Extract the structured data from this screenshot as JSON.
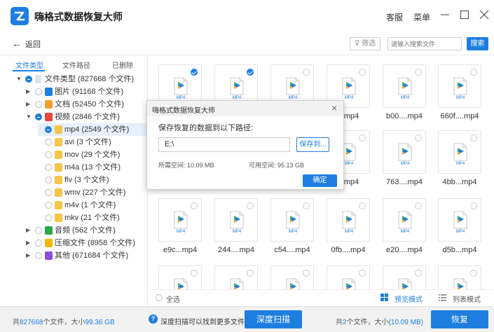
{
  "window": {
    "title": "嗨格式数据恢复大师",
    "service": "客服",
    "menu": "菜单"
  },
  "toolbar": {
    "back": "返回",
    "filter": "筛选",
    "search_placeholder": "请输入搜索文件",
    "search_button": "搜索"
  },
  "tabs": [
    "文件类型",
    "文件路径",
    "已删除"
  ],
  "tree": [
    {
      "label": "文件类型 (827668 个文件)"
    },
    {
      "label": "图片 (91168 个文件)",
      "color": "#1e7ee0"
    },
    {
      "label": "文档 (52450 个文件)",
      "color": "#f0a030"
    },
    {
      "label": "视频 (2846 个文件)",
      "color": "#e8453c"
    },
    {
      "label": "mp4 (2549 个文件)"
    },
    {
      "label": "avi (3 个文件)"
    },
    {
      "label": "mov (29 个文件)"
    },
    {
      "label": "m4a (13 个文件)"
    },
    {
      "label": "flv (3 个文件)"
    },
    {
      "label": "wmv (227 个文件)"
    },
    {
      "label": "m4v (1 个文件)"
    },
    {
      "label": "mkv (21 个文件)"
    },
    {
      "label": "音频 (562 个文件)",
      "color": "#2aa84a"
    },
    {
      "label": "压缩文件 (8958 个文件)",
      "color": "#f5b800"
    },
    {
      "label": "其他 (671684 个文件)",
      "color": "#8a4fd8"
    }
  ],
  "grid": {
    "badge": "MP4",
    "row2": [
      "",
      "",
      "...mp4",
      "b00....mp4",
      "660f....mp4"
    ],
    "row3": [
      "",
      "",
      "...mp4",
      "763....mp4",
      "4bb...mp4"
    ],
    "row4": [
      "e9c...mp4",
      "244....mp4",
      "c54....mp4",
      "0fb....mp4",
      "e20....mp4",
      "d5b...mp4"
    ]
  },
  "bottom": {
    "select_all": "全选",
    "preview_mode": "预览模式",
    "list_mode": "列表模式"
  },
  "status": {
    "total_prefix": "共",
    "total_count": "827668",
    "total_mid": "个文件，大小",
    "total_size": "99.36 GB",
    "tip": "深度扫描可以找到更多文件",
    "deep_scan": "深度扫描",
    "sel_prefix": "共",
    "sel_count": "2",
    "sel_mid": "个文件，大小",
    "sel_size": "(10.09 MB)",
    "recover": "恢复"
  },
  "dialog": {
    "title": "嗨格式数据恢复大师",
    "prompt": "保存恢复的数据到以下路径:",
    "path": "E:\\",
    "save_to": "保存到...",
    "needed_label": "所需空间:",
    "needed": "10.09 MB",
    "avail_label": "可用空间:",
    "avail": "95.13 GB",
    "ok": "确定"
  },
  "colors": {
    "accent": "#1e7ee0"
  }
}
